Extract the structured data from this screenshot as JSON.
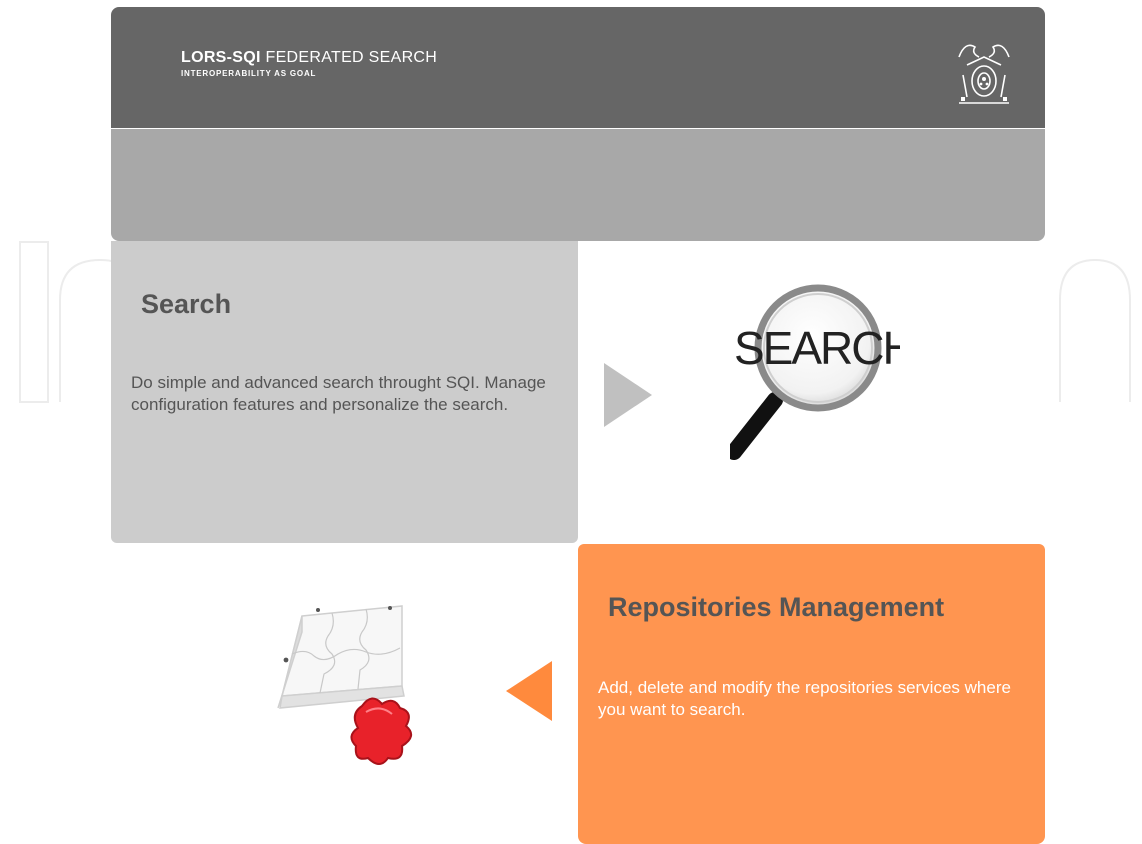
{
  "header": {
    "brand_bold": "LORS-SQI",
    "brand_rest": " FEDERATED SEARCH",
    "tagline": "INTEROPERABILITY AS GOAL",
    "logo_icon": "university-crest-icon"
  },
  "search_panel": {
    "title": "Search",
    "description": "Do simple and advanced search throught SQI. Manage configuration features and personalize the search.",
    "graphic_text": "SEARCH",
    "arrow_icon": "triangle-right-icon"
  },
  "repo_panel": {
    "title": "Repositories Management",
    "description": "Add, delete and modify the repositories services where you want to search.",
    "arrow_icon": "triangle-left-icon",
    "graphic_icon": "puzzle-pieces-icon"
  },
  "colors": {
    "header_bg": "#666666",
    "subbar_bg": "#a8a8a8",
    "search_panel_bg": "#cccccc",
    "repo_panel_bg": "#ff9550",
    "accent_arrow": "#ff8a3d"
  }
}
